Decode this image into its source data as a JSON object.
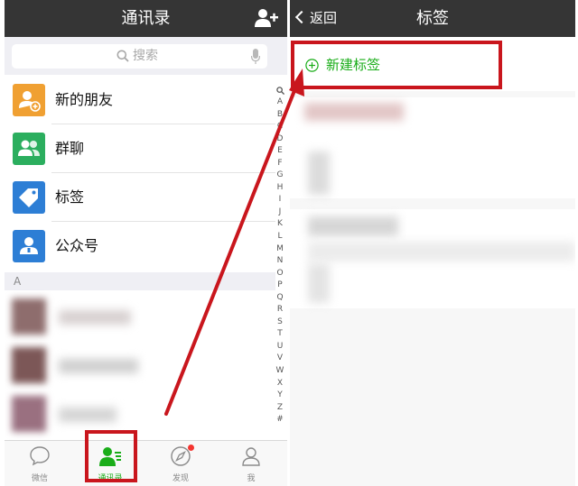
{
  "contacts_screen": {
    "title": "通讯录",
    "search": {
      "placeholder": "搜索"
    },
    "menu_items": [
      {
        "label": "新的朋友",
        "icon": "new-friends-icon",
        "color": "#f0a032"
      },
      {
        "label": "群聊",
        "icon": "group-chat-icon",
        "color": "#2bae5e"
      },
      {
        "label": "标签",
        "icon": "tag-icon",
        "color": "#2d7ed5"
      },
      {
        "label": "公众号",
        "icon": "official-account-icon",
        "color": "#2d7ed5"
      }
    ],
    "section_letter": "A",
    "index_letters": [
      "A",
      "B",
      "C",
      "D",
      "E",
      "F",
      "G",
      "H",
      "I",
      "J",
      "K",
      "L",
      "M",
      "N",
      "O",
      "P",
      "Q",
      "R",
      "S",
      "T",
      "U",
      "V",
      "W",
      "X",
      "Y",
      "Z",
      "#"
    ],
    "tabs": [
      {
        "label": "微信",
        "icon": "chat-bubble-icon",
        "active": false
      },
      {
        "label": "通讯录",
        "icon": "contacts-icon",
        "active": true
      },
      {
        "label": "发现",
        "icon": "compass-icon",
        "active": false
      },
      {
        "label": "我",
        "icon": "person-icon",
        "active": false
      }
    ]
  },
  "tags_screen": {
    "back_label": "返回",
    "title": "标签",
    "new_tag_label": "新建标签"
  },
  "colors": {
    "navbar": "#353535",
    "accent_green": "#1aad19",
    "highlight_red": "#c9161d",
    "badge_red": "#f43530"
  }
}
